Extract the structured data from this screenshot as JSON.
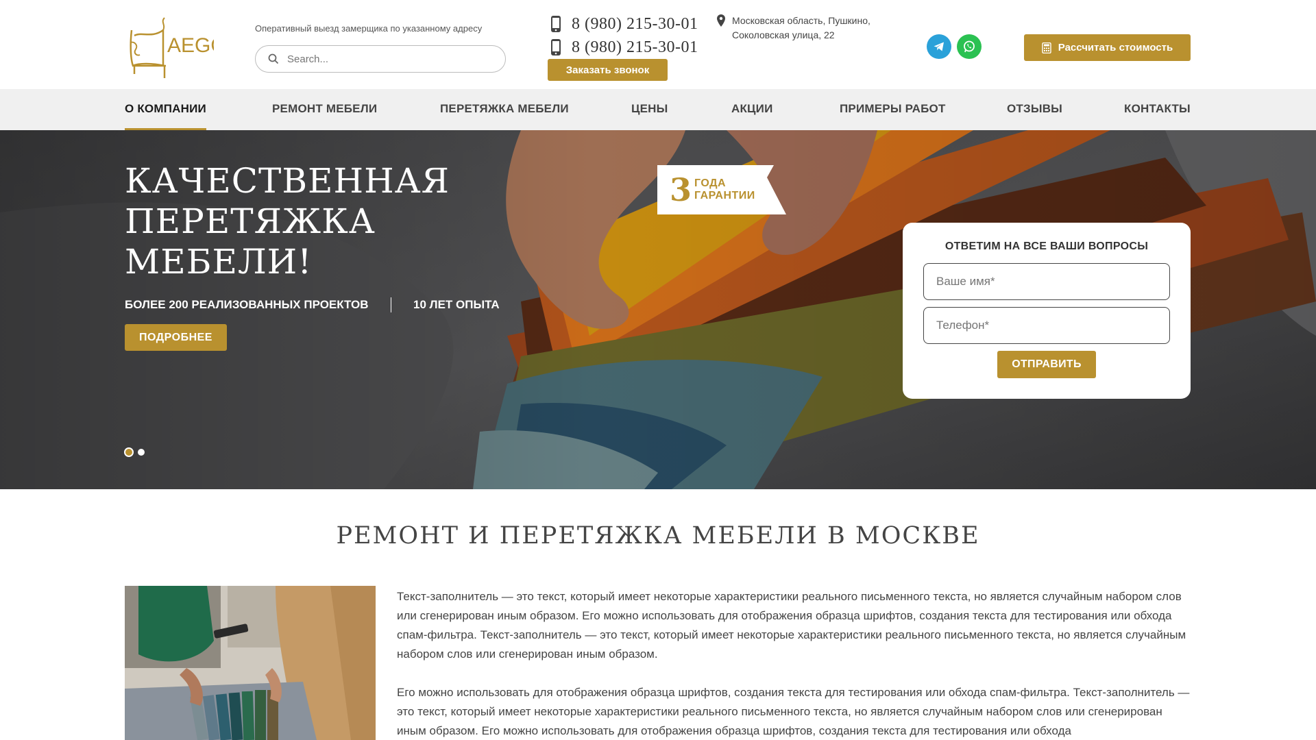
{
  "header": {
    "logo_text": "AEGO",
    "tagline": "Оперативный выезд замерщика по указанному адресу",
    "search": {
      "placeholder": "Search..."
    },
    "phones": [
      "8 (980) 215-30-01",
      "8 (980) 215-30-01"
    ],
    "callback_label": "Заказать звонок",
    "address": {
      "line1": "Московская область, Пушкино,",
      "line2": "Соколовская улица, 22"
    },
    "social": [
      "telegram-icon",
      "whatsapp-icon"
    ],
    "calc_label": "Рассчитать стоимость"
  },
  "nav": {
    "items": [
      {
        "label": "О КОМПАНИИ",
        "active": true
      },
      {
        "label": "РЕМОНТ МЕБЕЛИ",
        "active": false
      },
      {
        "label": "ПЕРЕТЯЖКА МЕБЕЛИ",
        "active": false
      },
      {
        "label": "ЦЕНЫ",
        "active": false
      },
      {
        "label": "АКЦИИ",
        "active": false
      },
      {
        "label": "ПРИМЕРЫ РАБОТ",
        "active": false
      },
      {
        "label": "ОТЗЫВЫ",
        "active": false
      },
      {
        "label": "КОНТАКТЫ",
        "active": false
      }
    ]
  },
  "hero": {
    "title_lines": [
      "КАЧЕСТВЕННАЯ",
      "ПЕРЕТЯЖКА",
      "МЕБЕЛИ!"
    ],
    "stat1": "БОЛЕЕ 200 РЕАЛИЗОВАННЫХ ПРОЕКТОВ",
    "stat2": "10 ЛЕТ ОПЫТА",
    "more_label": "ПОДРОБНЕЕ",
    "guarantee": {
      "number": "3",
      "line1": "ГОДА",
      "line2": "ГАРАНТИИ"
    },
    "slides_total": 2,
    "active_slide": 1
  },
  "form": {
    "title": "ОТВЕТИМ НА ВСЕ ВАШИ ВОПРОСЫ",
    "name_placeholder": "Ваше имя*",
    "phone_placeholder": "Телефон*",
    "submit_label": "ОТПРАВИТЬ"
  },
  "content": {
    "title": "РЕМОНТ И ПЕРЕТЯЖКА МЕБЕЛИ В МОСКВЕ",
    "paragraph1": "Текст-заполнитель — это текст, который имеет некоторые характеристики реального письменного текста, но является случайным набором слов или сгенерирован иным образом. Его можно использовать для отображения образца шрифтов, создания текста для тестирования или обхода спам-фильтра. Текст-заполнитель — это текст, который имеет некоторые характеристики реального письменного текста, но является случайным набором слов или сгенерирован иным образом.",
    "paragraph2": "Его можно использовать для отображения образца шрифтов, создания текста для тестирования или обхода спам-фильтра. Текст-заполнитель — это текст, который имеет некоторые характеристики реального письменного текста, но является случайным набором слов или сгенерирован иным образом. Его можно использовать для отображения образца шрифтов, создания текста для тестирования или обхода"
  },
  "colors": {
    "accent": "#b9912f",
    "nav_bg": "#f0f0f0",
    "telegram": "#2aa1d9",
    "whatsapp": "#2bc152"
  }
}
